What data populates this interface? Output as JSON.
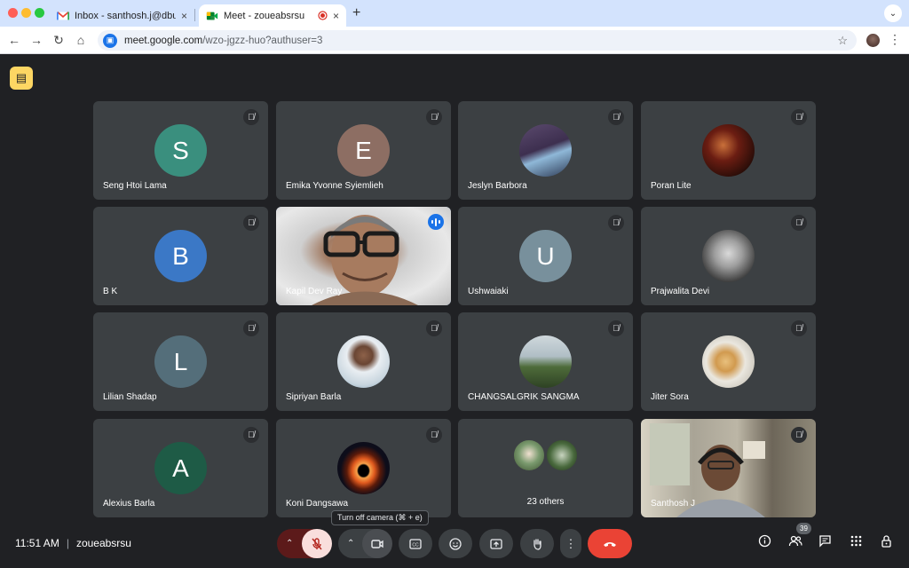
{
  "browser": {
    "tabs": [
      {
        "title": "Inbox - santhosh.j@dbuniversity",
        "close": "×"
      },
      {
        "title": "Meet - zoueabsrsu",
        "close": "×"
      }
    ],
    "new_tab": "+",
    "tab_menu": "⌄",
    "url_host": "meet.google.com",
    "url_path": "/wzo-jgzz-huo?authuser=3"
  },
  "participants": [
    {
      "name": "Seng Htoi Lama",
      "initial": "S",
      "color": "#3a8f7e"
    },
    {
      "name": "Emika Yvonne Syiemlieh",
      "initial": "E",
      "color": "#8d6e63"
    },
    {
      "name": "Jeslyn Barbora"
    },
    {
      "name": "Poran Lite"
    },
    {
      "name": "B K",
      "initial": "B",
      "color": "#3b78c6"
    },
    {
      "name": "Kapil Dev Ray"
    },
    {
      "name": "Ushwaiaki",
      "initial": "U",
      "color": "#78909c"
    },
    {
      "name": "Prajwalita Devi"
    },
    {
      "name": "Lilian Shadap",
      "initial": "L",
      "color": "#546e7a"
    },
    {
      "name": "Sipriyan Barla"
    },
    {
      "name": "CHANGSALGRIK SANGMA"
    },
    {
      "name": "Jiter Sora"
    },
    {
      "name": "Alexius Barla",
      "initial": "A",
      "color": "#1e5b46"
    },
    {
      "name": "Koni Dangsawa"
    },
    {
      "name": "23 others"
    },
    {
      "name": "Santhosh J"
    }
  ],
  "meeting": {
    "time": "11:51 AM",
    "separator": "|",
    "code": "zoueabsrsu",
    "tooltip": "Turn off camera (⌘ + e)",
    "people_count": "39"
  },
  "colors": {
    "speaking_outline": "#8ab4f8",
    "leave": "#ea4335",
    "mic_off_bg": "#f9dedc"
  }
}
